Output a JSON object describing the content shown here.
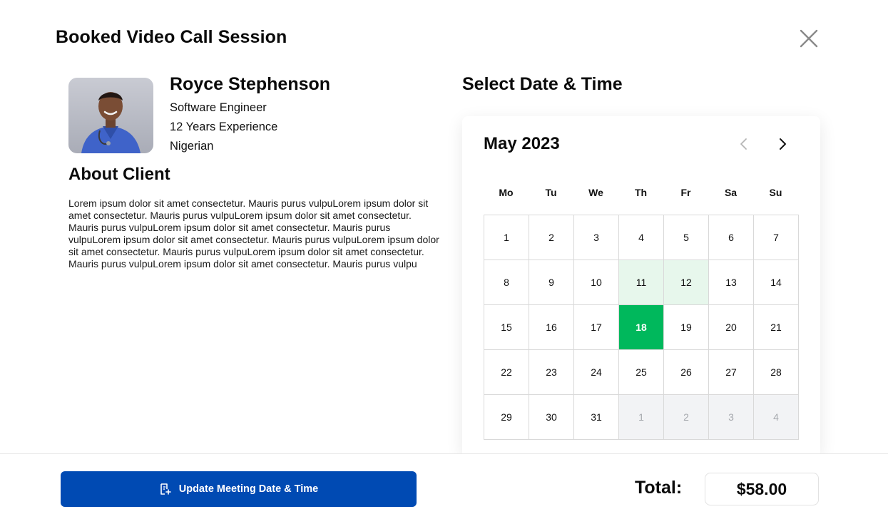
{
  "modal": {
    "title": "Booked Video Call Session"
  },
  "client": {
    "name": "Royce Stephenson",
    "role": "Software Engineer",
    "experience": "12 Years Experience",
    "nationality": "Nigerian",
    "avatar_icon": "person-photo"
  },
  "about": {
    "title": "About Client",
    "text": "Lorem ipsum dolor sit amet consectetur. Mauris purus vulpuLorem ipsum dolor sit amet consectetur. Mauris purus vulpuLorem ipsum dolor sit amet consectetur. Mauris purus vulpuLorem ipsum dolor sit amet consectetur. Mauris purus vulpuLorem ipsum dolor sit amet consectetur. Mauris purus vulpuLorem ipsum dolor sit amet consectetur. Mauris purus vulpuLorem ipsum dolor sit amet consectetur. Mauris purus vulpuLorem ipsum dolor sit amet consectetur. Mauris purus vulpu"
  },
  "calendar": {
    "section_title": "Select Date & Time",
    "month_label": "May 2023",
    "weekdays": [
      "Mo",
      "Tu",
      "We",
      "Th",
      "Fr",
      "Sa",
      "Su"
    ],
    "days": [
      {
        "label": "1",
        "state": "normal"
      },
      {
        "label": "2",
        "state": "normal"
      },
      {
        "label": "3",
        "state": "normal"
      },
      {
        "label": "4",
        "state": "normal"
      },
      {
        "label": "5",
        "state": "normal"
      },
      {
        "label": "6",
        "state": "normal"
      },
      {
        "label": "7",
        "state": "normal"
      },
      {
        "label": "8",
        "state": "normal"
      },
      {
        "label": "9",
        "state": "normal"
      },
      {
        "label": "10",
        "state": "normal"
      },
      {
        "label": "11",
        "state": "available"
      },
      {
        "label": "12",
        "state": "available"
      },
      {
        "label": "13",
        "state": "normal"
      },
      {
        "label": "14",
        "state": "normal"
      },
      {
        "label": "15",
        "state": "normal"
      },
      {
        "label": "16",
        "state": "normal"
      },
      {
        "label": "17",
        "state": "normal"
      },
      {
        "label": "18",
        "state": "selected"
      },
      {
        "label": "19",
        "state": "normal"
      },
      {
        "label": "20",
        "state": "normal"
      },
      {
        "label": "21",
        "state": "normal"
      },
      {
        "label": "22",
        "state": "normal"
      },
      {
        "label": "23",
        "state": "normal"
      },
      {
        "label": "24",
        "state": "normal"
      },
      {
        "label": "25",
        "state": "normal"
      },
      {
        "label": "26",
        "state": "normal"
      },
      {
        "label": "27",
        "state": "normal"
      },
      {
        "label": "28",
        "state": "normal"
      },
      {
        "label": "29",
        "state": "normal"
      },
      {
        "label": "30",
        "state": "normal"
      },
      {
        "label": "31",
        "state": "normal"
      },
      {
        "label": "1",
        "state": "outside"
      },
      {
        "label": "2",
        "state": "outside"
      },
      {
        "label": "3",
        "state": "outside"
      },
      {
        "label": "4",
        "state": "outside"
      }
    ],
    "prev_icon": "chevron-left-icon",
    "next_icon": "chevron-right-icon"
  },
  "footer": {
    "update_label": "Update Meeting Date & Time",
    "update_icon": "calendar-edit-icon",
    "total_label": "Total:",
    "total_value": "$58.00"
  },
  "colors": {
    "primary": "#004ab3",
    "selected_day": "#00b85c",
    "available_day": "#e7f7ec",
    "outside_day": "#f2f3f5"
  }
}
